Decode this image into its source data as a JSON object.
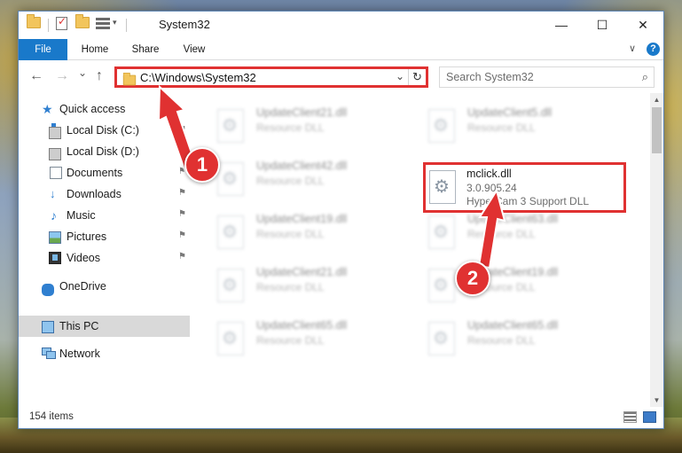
{
  "window": {
    "title": "System32",
    "controls": {
      "minimize": "—",
      "maximize": "☐",
      "close": "✕"
    }
  },
  "ribbon": {
    "tabs": [
      "File",
      "Home",
      "Share",
      "View"
    ],
    "collapse_glyph": "∨",
    "help_glyph": "?"
  },
  "nav": {
    "back": "←",
    "forward": "→",
    "recent": "⌄",
    "up": "↑",
    "address": "C:\\Windows\\System32",
    "address_dropdown": "⌄",
    "refresh": "↻",
    "search_placeholder": "Search System32",
    "search_icon": "⌕"
  },
  "sidebar": {
    "items": [
      {
        "label": "Quick access",
        "icon": "star-icon",
        "pinned": false
      },
      {
        "label": "Local Disk (C:)",
        "icon": "drive-icon",
        "pinned": true
      },
      {
        "label": "Local Disk (D:)",
        "icon": "drive-icon",
        "pinned": true
      },
      {
        "label": "Documents",
        "icon": "documents-icon",
        "pinned": true
      },
      {
        "label": "Downloads",
        "icon": "downloads-icon",
        "pinned": true
      },
      {
        "label": "Music",
        "icon": "music-icon",
        "pinned": true
      },
      {
        "label": "Pictures",
        "icon": "pictures-icon",
        "pinned": true
      },
      {
        "label": "Videos",
        "icon": "videos-icon",
        "pinned": true
      },
      {
        "label": "OneDrive",
        "icon": "onedrive-icon",
        "pinned": false
      },
      {
        "label": "This PC",
        "icon": "this-pc-icon",
        "pinned": false,
        "selected": true
      },
      {
        "label": "Network",
        "icon": "network-icon",
        "pinned": false
      }
    ],
    "pin_glyph": "⚑"
  },
  "files": {
    "left_column": [
      {
        "name": "UpdateClient21.dll",
        "type": "Resource DLL"
      },
      {
        "name": "UpdateClient42.dll",
        "type": "Resource DLL"
      },
      {
        "name": "UpdateClient19.dll",
        "type": "Resource DLL"
      },
      {
        "name": "UpdateClient21.dll",
        "type": "Resource DLL"
      },
      {
        "name": "UpdateClient65.dll",
        "type": "Resource DLL"
      }
    ],
    "right_column": [
      {
        "name": "UpdateClient5.dll",
        "type": "Resource DLL"
      },
      {
        "name": "mclick.dll",
        "version": "3.0.905.24",
        "type": "HyperCam 3 Support DLL",
        "highlighted": true
      },
      {
        "name": "UpdateClient63.dll",
        "type": "Resource DLL"
      },
      {
        "name": "UpdateClient19.dll",
        "type": "Resource DLL"
      },
      {
        "name": "UpdateClient65.dll",
        "type": "Resource DLL"
      }
    ],
    "gear_glyph": "⚙"
  },
  "status": {
    "item_count": "154 items"
  },
  "annotations": {
    "step1": "1",
    "step2": "2",
    "color": "#e03131"
  }
}
